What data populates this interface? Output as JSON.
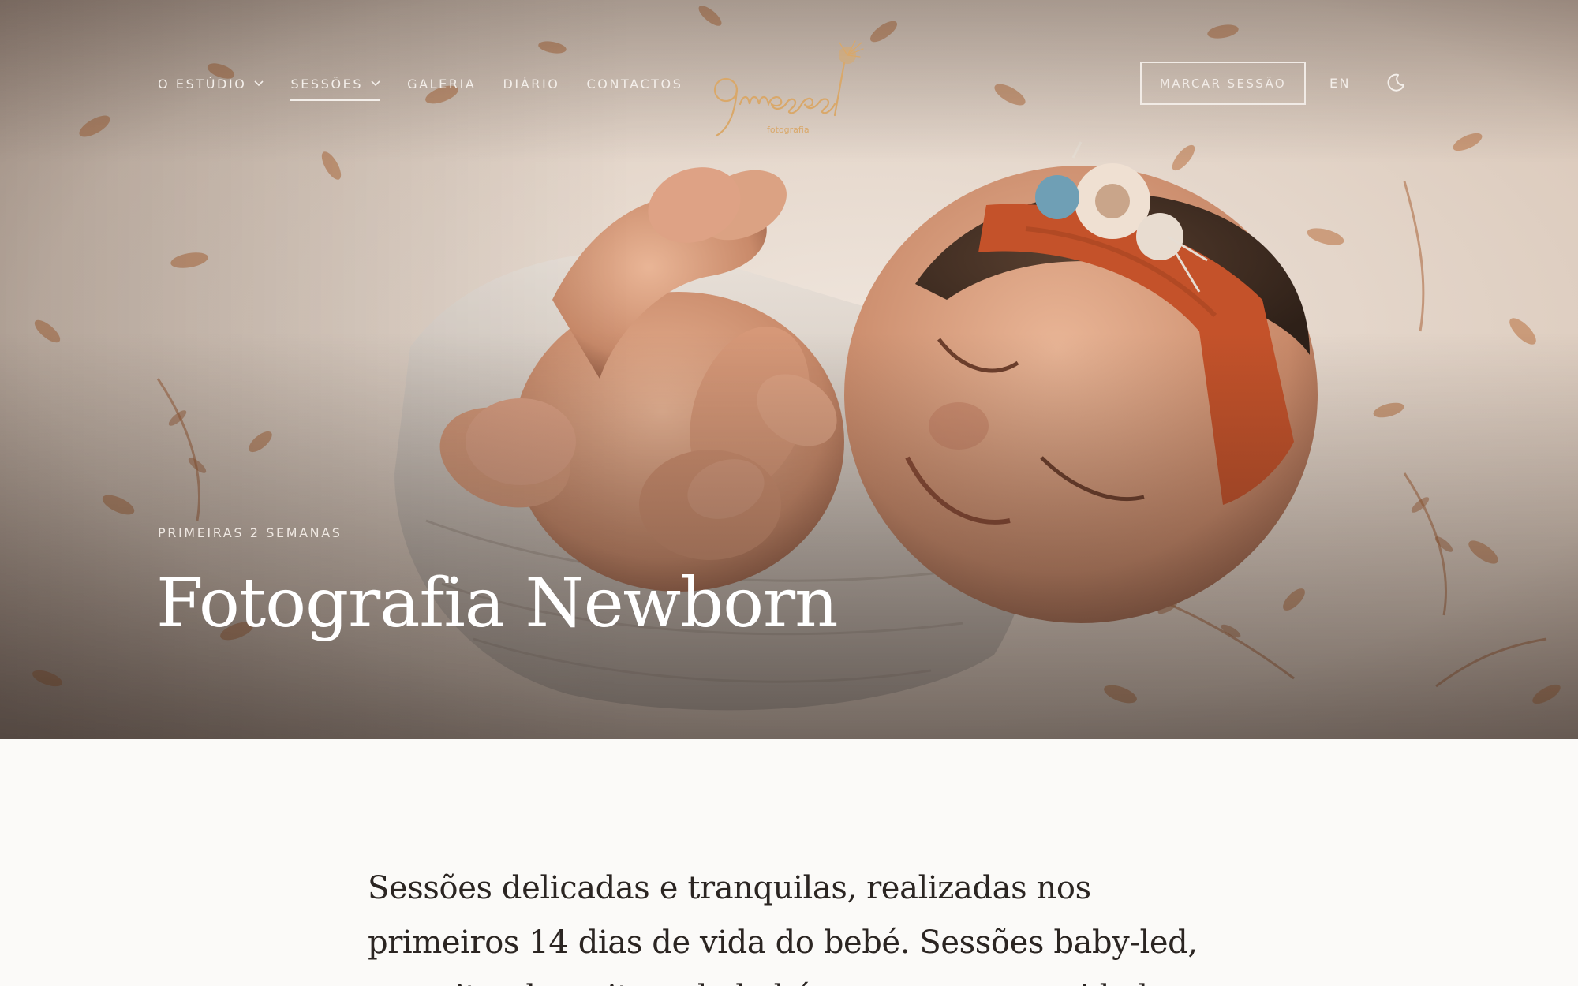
{
  "nav": {
    "items": [
      {
        "label": "O ESTÚDIO",
        "has_dropdown": true,
        "active": false
      },
      {
        "label": "SESSÕES",
        "has_dropdown": true,
        "active": true
      },
      {
        "label": "GALERIA",
        "has_dropdown": false,
        "active": false
      },
      {
        "label": "DIÁRIO",
        "has_dropdown": false,
        "active": false
      },
      {
        "label": "CONTACTOS",
        "has_dropdown": false,
        "active": false
      }
    ],
    "cta_label": "MARCAR SESSÃO",
    "language_label": "EN",
    "theme_icon": "moon-icon"
  },
  "logo": {
    "wordmark": "9meses",
    "tagline": "fotografia",
    "color": "#d9a86a"
  },
  "hero": {
    "eyebrow": "PRIMEIRAS 2 SEMANAS",
    "title": "Fotografia Newborn",
    "image_alt": "Recém-nascido a dormir enrolado numa manta, com fita laranja e flores na cabeça"
  },
  "intro": {
    "text": "Sessões delicadas e tranquilas, realizadas nos primeiros 14 dias de vida do bebé. Sessões baby-led, respeitando o ritmo do bebé e as suas necessidades."
  },
  "colors": {
    "accent": "#c4622d",
    "background": "#fbfaf8",
    "text": "#2b2522"
  }
}
